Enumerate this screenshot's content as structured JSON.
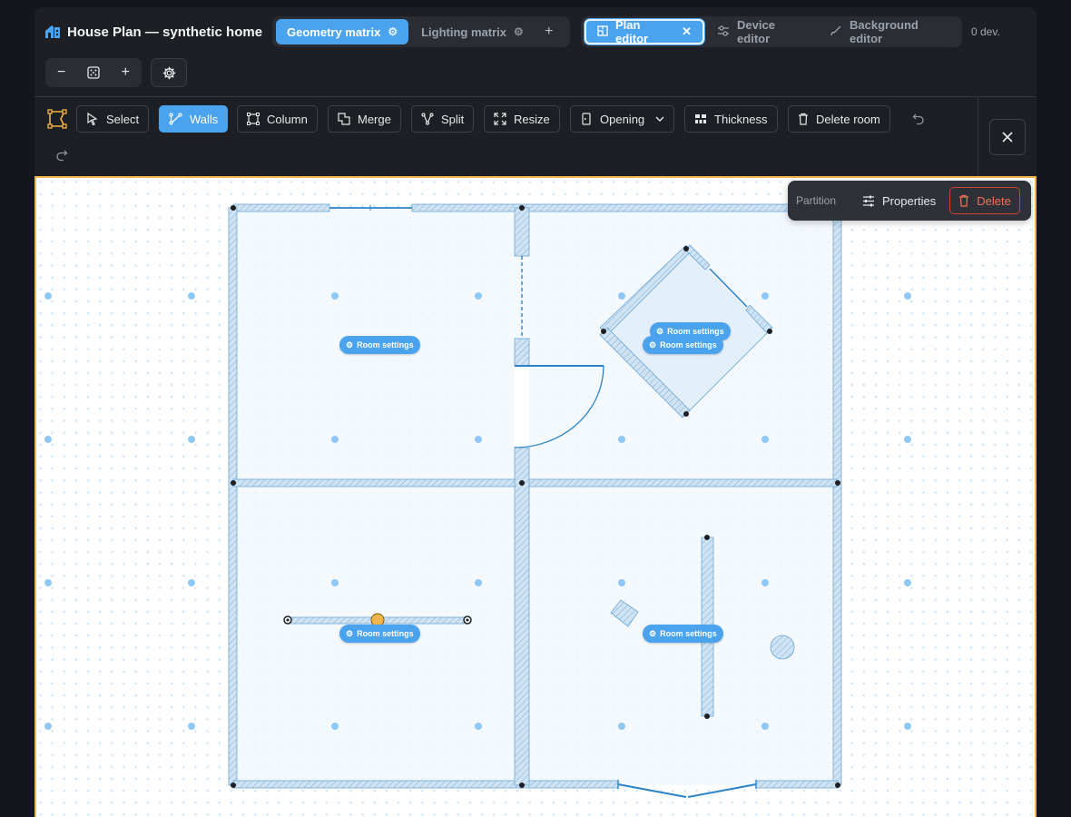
{
  "header": {
    "title": "House Plan — synthetic home",
    "matrix_tabs": [
      {
        "label": "Geometry matrix",
        "active": true
      },
      {
        "label": "Lighting matrix",
        "active": false
      }
    ],
    "editor_tabs": [
      {
        "label": "Plan editor",
        "active": true
      },
      {
        "label": "Device editor",
        "active": false
      },
      {
        "label": "Background editor",
        "active": false
      }
    ],
    "device_count": "0 dev."
  },
  "zoom": {
    "minus": "−",
    "plus": "+"
  },
  "toolbar": {
    "tools": [
      {
        "label": "Select"
      },
      {
        "label": "Walls",
        "active": true
      },
      {
        "label": "Column"
      },
      {
        "label": "Merge"
      },
      {
        "label": "Split"
      },
      {
        "label": "Resize"
      },
      {
        "label": "Opening"
      },
      {
        "label": "Thickness"
      },
      {
        "label": "Delete room"
      }
    ]
  },
  "popover": {
    "label": "Partition",
    "properties_label": "Properties",
    "delete_label": "Delete"
  },
  "room_chips": [
    {
      "label": "Room settings"
    },
    {
      "label": "Room settings"
    },
    {
      "label": "Room settings"
    },
    {
      "label": "Room settings"
    },
    {
      "label": "Room settings"
    }
  ],
  "colors": {
    "accent": "#4ba3ee",
    "canvas_border": "#f0b44c",
    "wall_stroke": "#2a83c8",
    "delete": "#f06e55"
  }
}
